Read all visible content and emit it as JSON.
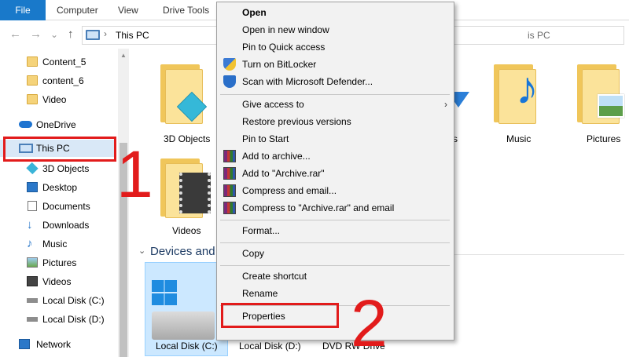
{
  "ribbon": {
    "tabs": [
      "File",
      "Computer",
      "View",
      "Drive Tools"
    ]
  },
  "address": {
    "path": "This PC",
    "path_right": "is PC",
    "separator": "›"
  },
  "nav": {
    "back": "←",
    "forward": "→",
    "recent": "⌄",
    "up": "↑"
  },
  "sidebar": {
    "items": [
      {
        "label": "Content_5",
        "icon": "folder-icon"
      },
      {
        "label": "content_6",
        "icon": "folder-icon"
      },
      {
        "label": "Video",
        "icon": "folder-icon"
      },
      {
        "label": "OneDrive",
        "icon": "cloud-icon"
      },
      {
        "label": "This PC",
        "icon": "computer-icon"
      },
      {
        "label": "3D Objects",
        "icon": "cube-icon"
      },
      {
        "label": "Desktop",
        "icon": "desktop-icon"
      },
      {
        "label": "Documents",
        "icon": "document-icon"
      },
      {
        "label": "Downloads",
        "icon": "download-icon"
      },
      {
        "label": "Music",
        "icon": "music-icon"
      },
      {
        "label": "Pictures",
        "icon": "picture-icon"
      },
      {
        "label": "Videos",
        "icon": "video-icon"
      },
      {
        "label": "Local Disk (C:)",
        "icon": "drive-icon"
      },
      {
        "label": "Local Disk (D:)",
        "icon": "drive-icon"
      },
      {
        "label": "Network",
        "icon": "network-icon"
      }
    ]
  },
  "main": {
    "folders": [
      "3D Objects",
      "s",
      "Music",
      "Pictures",
      "Videos"
    ],
    "section_title": "Devices and",
    "drives": [
      "Local Disk (C:)",
      "Local Disk (D:)",
      "DVD RW Drive"
    ]
  },
  "menu": {
    "items": [
      {
        "label": "Open",
        "bold": true
      },
      {
        "label": "Open in new window"
      },
      {
        "label": "Pin to Quick access"
      },
      {
        "label": "Turn on BitLocker",
        "icon": "bitlocker-shield-icon"
      },
      {
        "label": "Scan with Microsoft Defender...",
        "icon": "defender-icon"
      },
      {
        "label": "Give access to",
        "submenu": true
      },
      {
        "label": "Restore previous versions"
      },
      {
        "label": "Pin to Start"
      },
      {
        "label": "Add to archive...",
        "icon": "winrar-icon"
      },
      {
        "label": "Add to \"Archive.rar\"",
        "icon": "winrar-icon"
      },
      {
        "label": "Compress and email...",
        "icon": "winrar-icon"
      },
      {
        "label": "Compress to \"Archive.rar\" and email",
        "icon": "winrar-icon"
      },
      {
        "label": "Format..."
      },
      {
        "label": "Copy"
      },
      {
        "label": "Create shortcut"
      },
      {
        "label": "Rename"
      },
      {
        "label": "Properties"
      }
    ],
    "submenu_arrow": "›"
  },
  "annotations": {
    "step1": "1",
    "step2": "2",
    "color": "#e21b1b"
  }
}
